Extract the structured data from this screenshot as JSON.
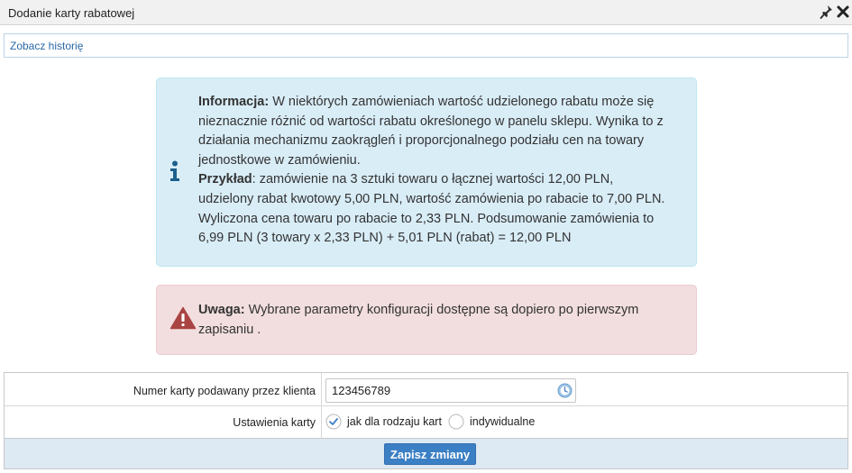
{
  "window": {
    "title": "Dodanie karty rabatowej"
  },
  "history_link": "Zobacz historię",
  "info_alert": {
    "label": "Informacja:",
    "text": " W niektórych zamówieniach wartość udzielonego rabatu może się nieznacznie różnić od wartości rabatu określonego w panelu sklepu. Wynika to z działania mechanizmu zaokrągleń i proporcjonalnego podziału cen na towary jednostkowe w zamówieniu.",
    "example_label": "Przykład",
    "example_text": ": zamówienie na 3 sztuki towaru o łącznej wartości 12,00 PLN, udzielony rabat kwotowy 5,00 PLN, wartość zamówienia po rabacie to 7,00 PLN. Wyliczona cena towaru po rabacie to 2,33 PLN. Podsumowanie zamówienia to 6,99 PLN (3 towary x 2,33 PLN) + 5,01 PLN (rabat) = 12,00 PLN"
  },
  "warning_alert": {
    "label": "Uwaga:",
    "text": " Wybrane parametry konfiguracji dostępne są dopiero po pierwszym zapisaniu ."
  },
  "form": {
    "card_number_label": "Numer karty podawany przez klienta",
    "card_number_value": "123456789",
    "settings_label": "Ustawienia karty",
    "options": [
      {
        "label": "jak dla rodzaju kart",
        "selected": true
      },
      {
        "label": "indywidualne",
        "selected": false
      }
    ],
    "save_label": "Zapisz zmiany"
  },
  "colors": {
    "info_bg": "#d9edf7",
    "warning_bg": "#f2dede",
    "accent": "#3b7fc4",
    "link": "#2a67a8"
  },
  "icons": {
    "pin": "pin-icon",
    "close": "close-icon",
    "info": "info-icon",
    "warning": "warning-icon",
    "history": "history-icon",
    "radio_checked": "radio-checked-icon",
    "radio_unchecked": "radio-unchecked-icon"
  }
}
